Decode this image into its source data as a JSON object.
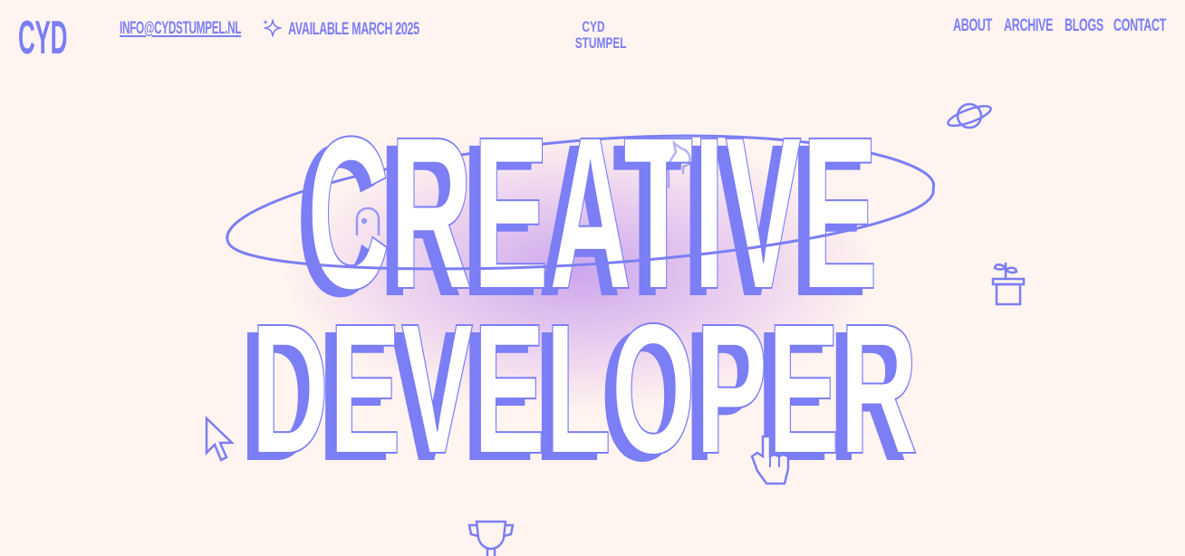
{
  "header": {
    "logo": "CYD",
    "email": "INFO@CYDSTUMPEL.NL",
    "availability": "AVAILABLE MARCH 2025",
    "availability_icon": "sparkle-icon",
    "center_name_line1": "CYD",
    "center_name_line2": "STUMPEL"
  },
  "nav": {
    "items": [
      {
        "label": "ABOUT"
      },
      {
        "label": "ARCHIVE"
      },
      {
        "label": "BLOGS"
      },
      {
        "label": "CONTACT"
      }
    ]
  },
  "hero": {
    "line1": "CREATIVE",
    "line2": "DEVELOPER"
  },
  "decorations": [
    "planet-icon",
    "plant-pot-icon",
    "cursor-arrow-icon",
    "hand-pointer-icon",
    "trophy-icon",
    "ghost-icon",
    "chess-knight-icon"
  ],
  "colors": {
    "accent": "#7b7ef5",
    "background": "#fff4ef",
    "glow": "#c79af0"
  }
}
